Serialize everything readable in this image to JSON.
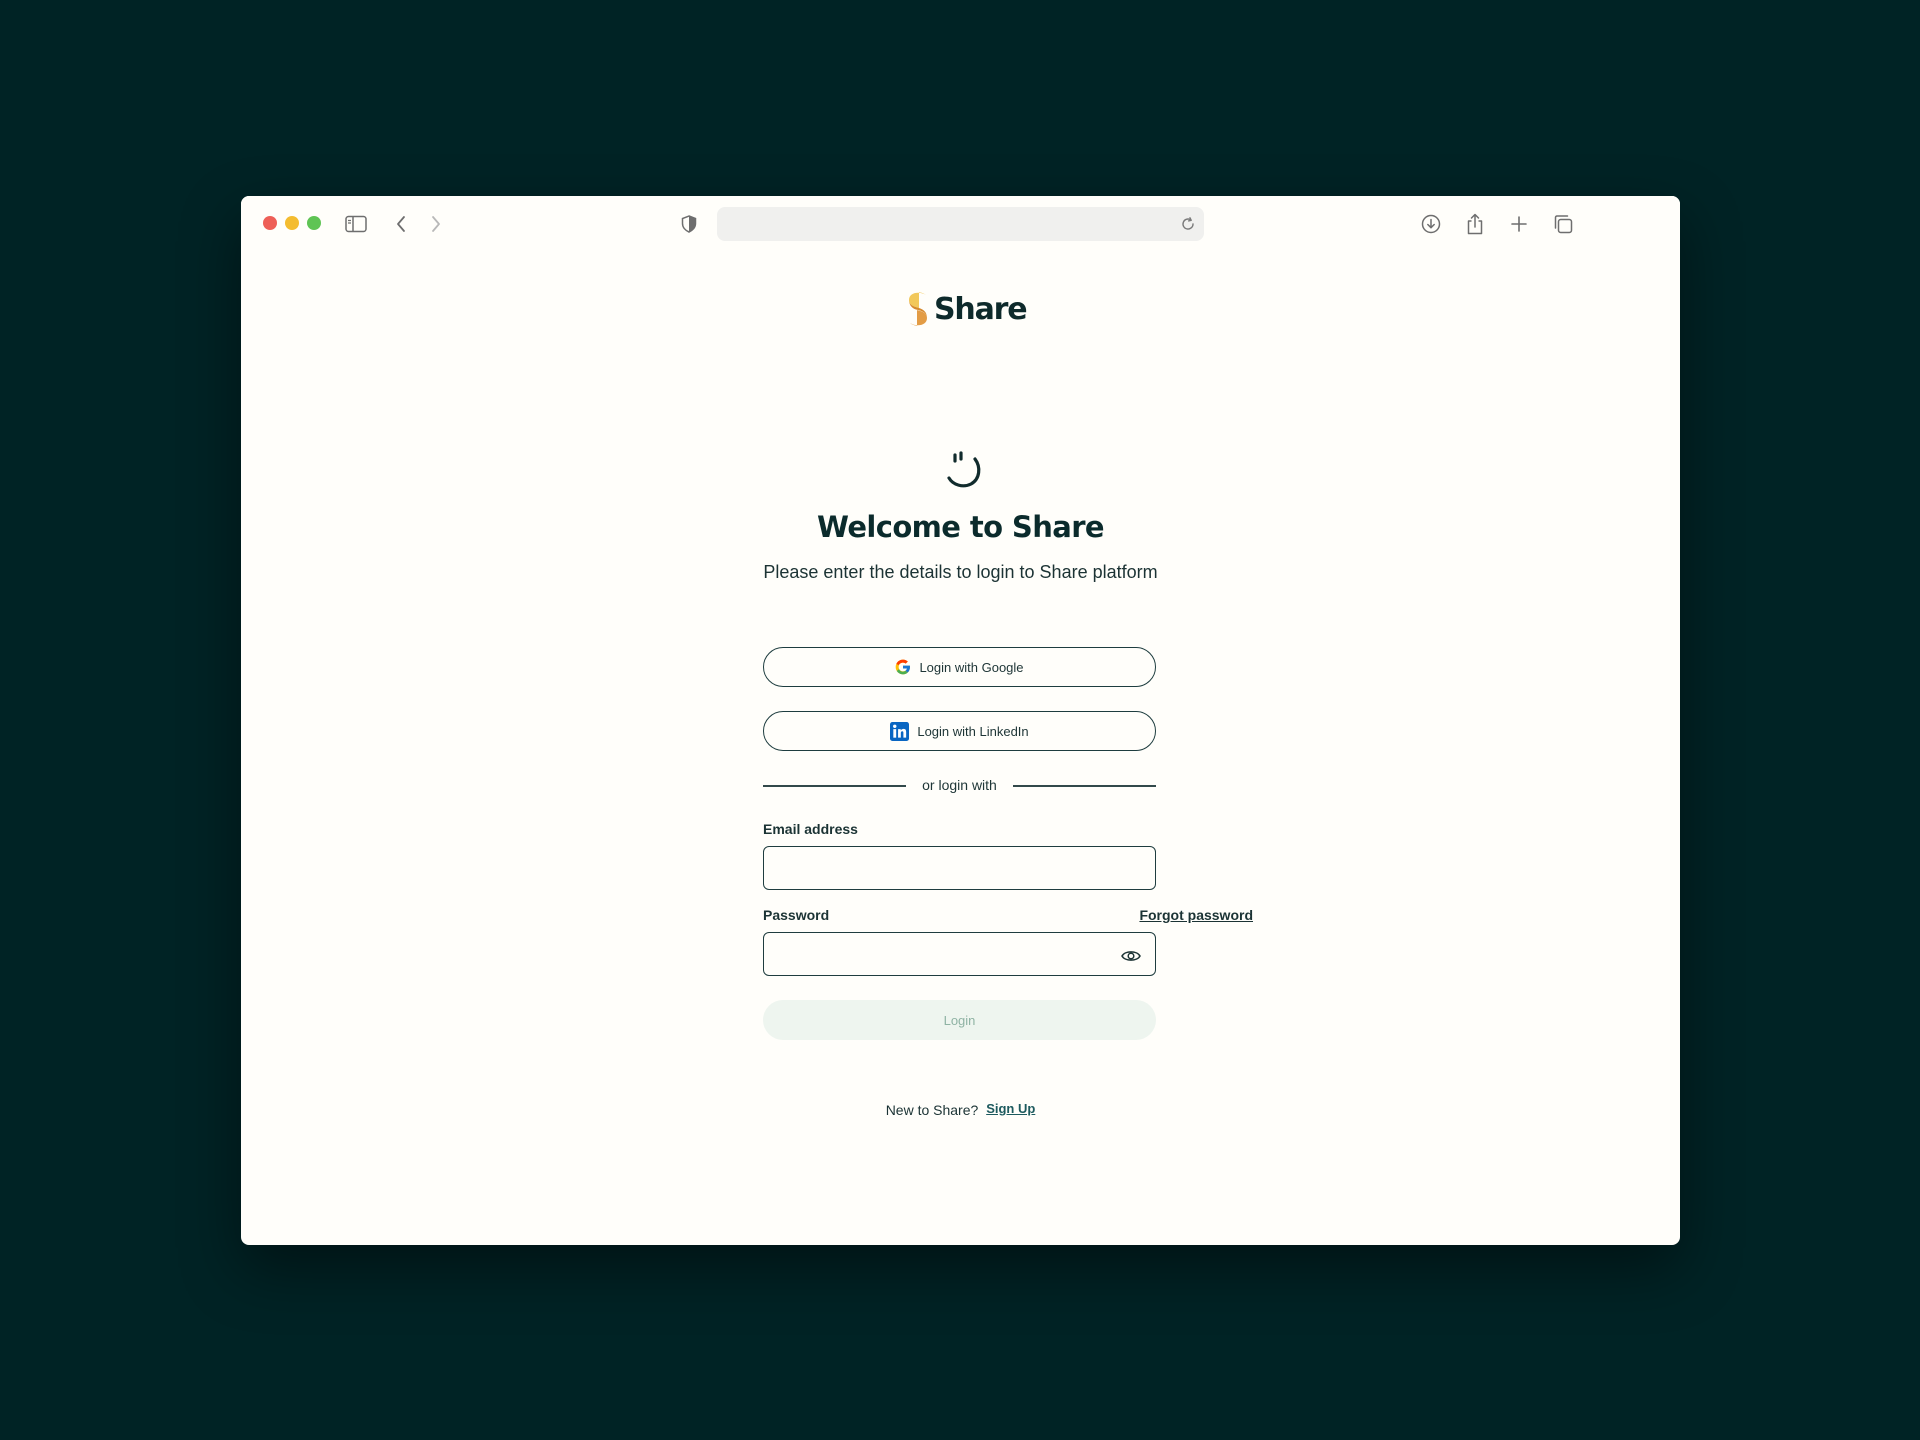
{
  "browser": {
    "url": "",
    "icons": {
      "sidebar": "sidebar-icon",
      "back": "chevron-left-icon",
      "forward": "chevron-right-icon",
      "shield": "shield-icon",
      "reload": "reload-icon",
      "download": "download-icon",
      "share": "share-icon",
      "new_tab": "plus-icon",
      "tabs": "tabs-overview-icon"
    }
  },
  "brand": {
    "name": "Share",
    "accent_color": "#e3a94c",
    "text_color": "#0b2b2c"
  },
  "login": {
    "title": "Welcome to Share",
    "subtitle": "Please enter the details to login to Share platform",
    "google_label": "Login with Google",
    "linkedin_label": "Login with LinkedIn",
    "divider_text": "or login with",
    "email_label": "Email address",
    "email_value": "",
    "password_label": "Password",
    "password_value": "",
    "forgot_label": "Forgot password",
    "login_label": "Login",
    "signup_prompt": "New to Share?",
    "signup_label": "Sign Up"
  }
}
